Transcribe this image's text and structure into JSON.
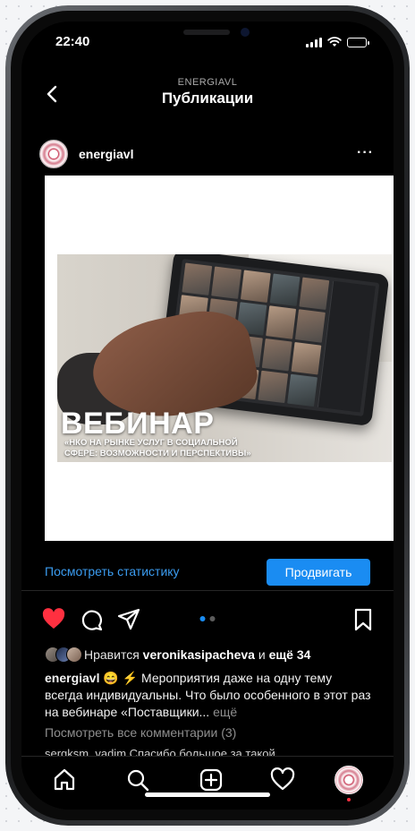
{
  "status_bar": {
    "time": "22:40"
  },
  "nav": {
    "account": "ENERGIAVL",
    "title": "Публикации"
  },
  "post": {
    "username": "energiavl",
    "more_label": "···",
    "image": {
      "headline": "ВЕБИНАР",
      "subtitle_line1": "«НКО на рынке услуг в социальной",
      "subtitle_line2": "сфере: возможности и перспективы»"
    },
    "stats_link": "Посмотреть статистику",
    "promote_label": "Продвигать",
    "likes": {
      "prefix": "Нравится",
      "user": "veronikasipacheva",
      "connector": "и",
      "others": "ещё 34"
    },
    "caption": {
      "author": "energiavl",
      "text": "😄 ⚡ Мероприятия даже на одну тему всегда индивидуальны. Что было особенного в этот раз на вебинаре «Поставщики...",
      "more": "ещё"
    },
    "view_comments": "Посмотреть все комментарии (3)",
    "comment_peek": "sergksm_vadim Спасибо большое за такой"
  },
  "colors": {
    "accent": "#1a8cf2",
    "link": "#3b9cf0",
    "like": "#ff3040",
    "background": "#000000"
  },
  "icons": {
    "back": "chevron-left-icon",
    "like": "heart-filled-icon",
    "comment": "comment-icon",
    "share": "send-icon",
    "save": "bookmark-icon",
    "tabs": [
      "home-icon",
      "search-icon",
      "add-post-icon",
      "heart-icon",
      "profile-icon"
    ]
  }
}
